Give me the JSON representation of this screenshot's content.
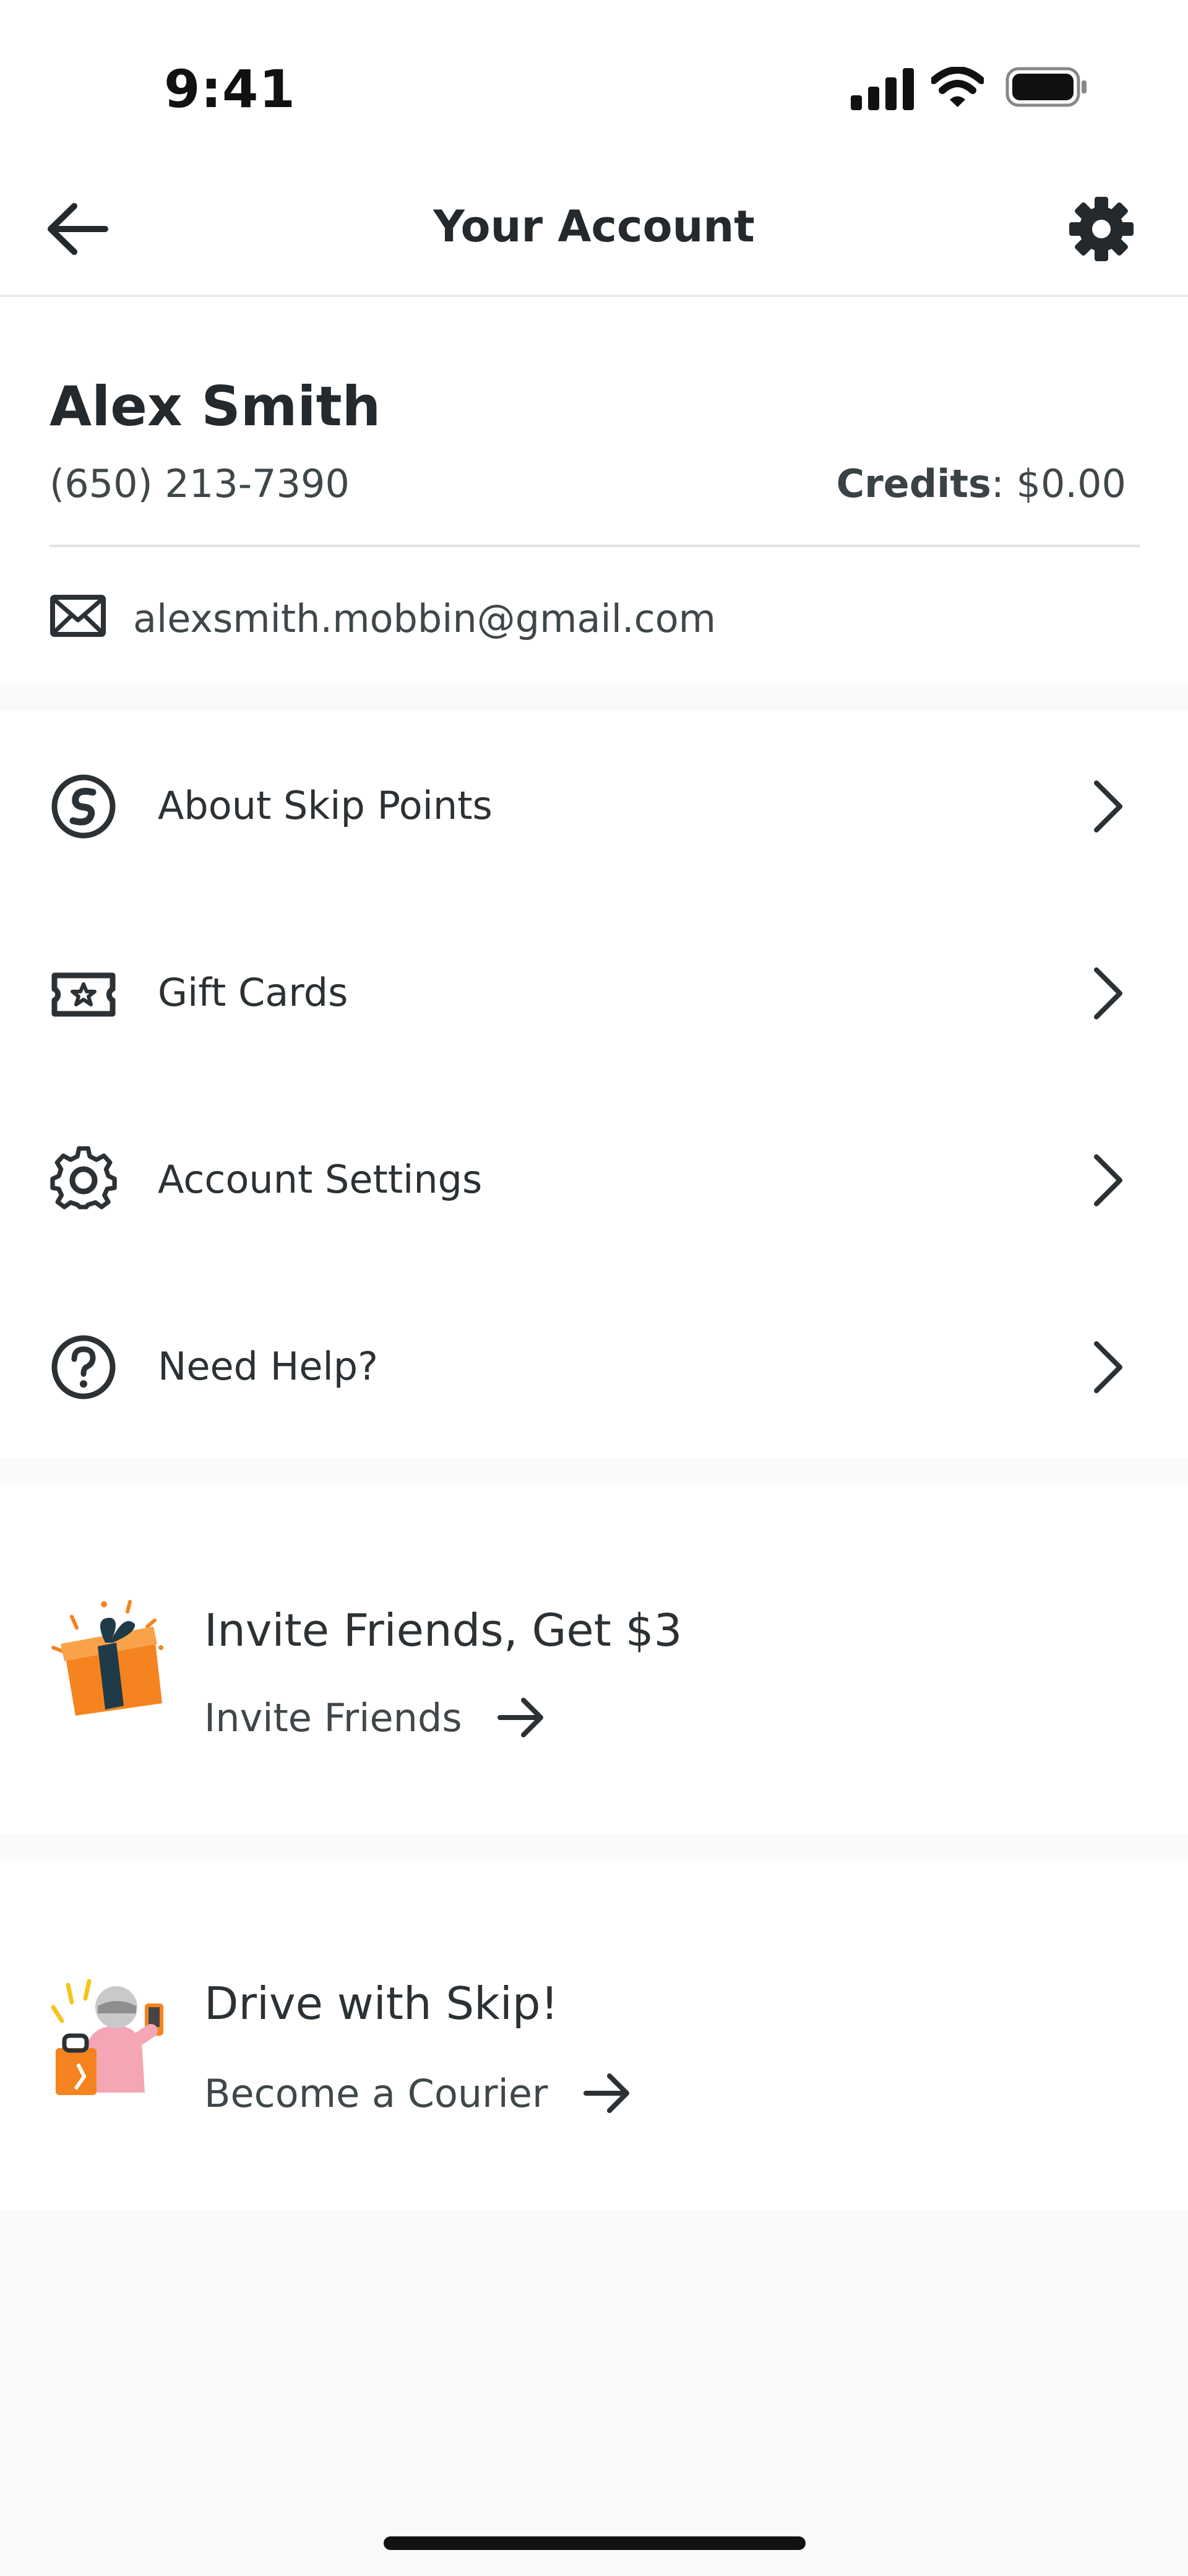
{
  "status_bar": {
    "time": "9:41"
  },
  "nav": {
    "title": "Your Account",
    "back_icon": "arrow-left-icon",
    "settings_icon": "gear-icon"
  },
  "profile": {
    "name": "Alex Smith",
    "phone": "(650) 213-7390",
    "credits_label": "Credits",
    "credits_sep": ":",
    "credits_value": "$0.00",
    "email": "alexsmith.mobbin@gmail.com"
  },
  "menu": {
    "items": [
      {
        "label": "About Skip Points",
        "icon": "skip-points-icon"
      },
      {
        "label": "Gift Cards",
        "icon": "gift-card-icon"
      },
      {
        "label": "Account Settings",
        "icon": "settings-icon"
      },
      {
        "label": "Need Help?",
        "icon": "help-icon"
      }
    ]
  },
  "promos": [
    {
      "title": "Invite Friends, Get $3",
      "link": "Invite Friends",
      "illustration": "gift-box-illustration"
    },
    {
      "title": "Drive with Skip!",
      "link": "Become a Courier",
      "illustration": "courier-illustration"
    }
  ],
  "colors": {
    "text": "#2b3134",
    "accent_orange": "#f5831f",
    "background": "#fafafa"
  }
}
